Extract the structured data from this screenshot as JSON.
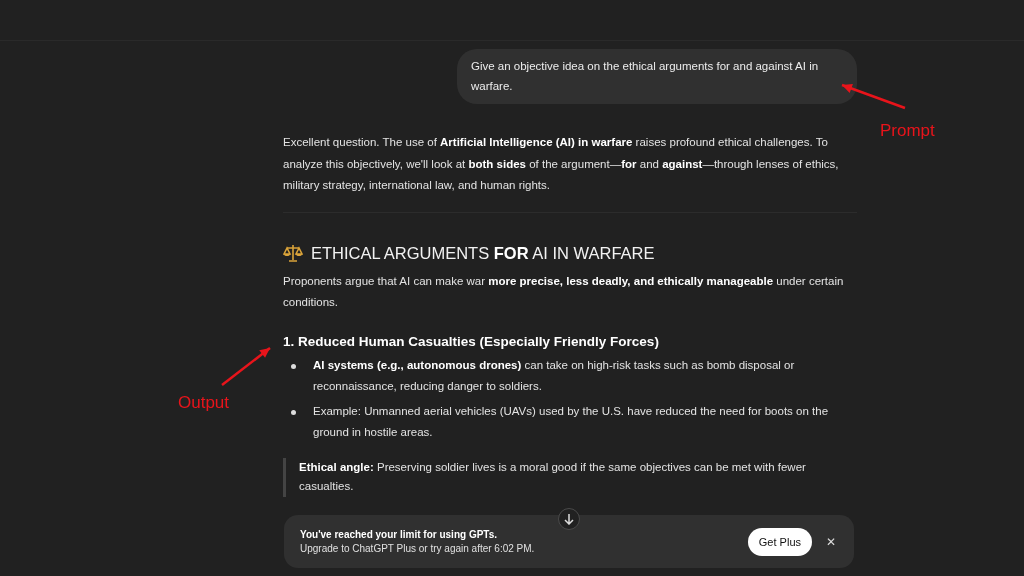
{
  "prompt": {
    "text": "Give an objective idea on the ethical arguments for and against AI in warfare."
  },
  "response": {
    "intro": "Excellent question. The use of **Artificial Intelligence (AI) in warfare** raises profound ethical challenges. To analyze this objectively, we'll look at **both sides** of the argument—**for** and **against**—through lenses of ethics, military strategy, international law, and human rights.",
    "heading": "ETHICAL ARGUMENTS **FOR** AI IN WARFARE",
    "lead": "Proponents argue that AI can make war **more precise, less deadly, and ethically manageable** under certain conditions.",
    "subheading": "1. Reduced Human Casualties (Especially Friendly Forces)",
    "bullets": [
      "**AI systems (e.g., autonomous drones)** can take on high-risk tasks such as bomb disposal or reconnaissance, reducing danger to soldiers.",
      "Example: Unmanned aerial vehicles (UAVs) used by the U.S. have reduced the need for boots on the ground in hostile areas."
    ],
    "quote": "**Ethical angle:** Preserving soldier lives is a moral good if the same objectives can be met with fewer casualties."
  },
  "banner": {
    "title": "You've reached your limit for using GPTs.",
    "message": "Upgrade to ChatGPT Plus or try again after 6:02 PM.",
    "button": "Get Plus",
    "close": "✕"
  },
  "annotations": [
    {
      "label": "Prompt"
    },
    {
      "label": "Output"
    }
  ]
}
